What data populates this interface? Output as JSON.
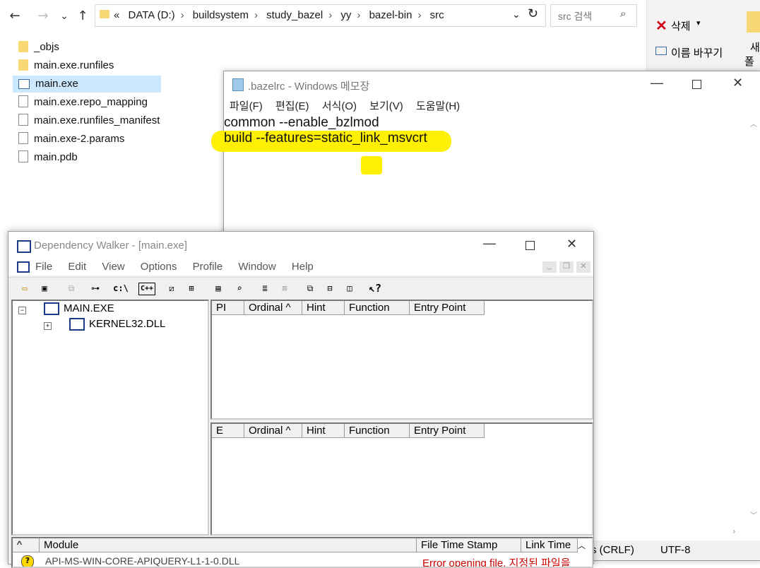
{
  "explorer": {
    "nav": {
      "back": "←",
      "forward": "→",
      "recent": "⌄",
      "up": "↑"
    },
    "address": {
      "chevron": "«",
      "crumbs": [
        "DATA (D:)",
        "buildsystem",
        "study_bazel",
        "yy",
        "bazel-bin",
        "src"
      ]
    },
    "search_placeholder": "src 검색",
    "files": [
      {
        "name": "_objs",
        "type": "folder"
      },
      {
        "name": "main.exe.runfiles",
        "type": "folder"
      },
      {
        "name": "main.exe",
        "type": "exe"
      },
      {
        "name": "main.exe.repo_mapping",
        "type": "doc"
      },
      {
        "name": "main.exe.runfiles_manifest",
        "type": "doc"
      },
      {
        "name": "main.exe-2.params",
        "type": "doc"
      },
      {
        "name": "main.pdb",
        "type": "doc"
      }
    ],
    "ribbon": {
      "delete": "삭제",
      "rename": "이름 바꾸기",
      "new_folder_1": "새",
      "new_folder_2": "폴더"
    }
  },
  "notepad": {
    "title": ".bazelrc - Windows 메모장",
    "menu": [
      "파일(F)",
      "편집(E)",
      "서식(O)",
      "보기(V)",
      "도움말(H)"
    ],
    "lines": [
      "common --enable_bzlmod",
      "build --features=static_link_msvcrt"
    ],
    "highlight_color": "#ffef00",
    "status_eol": "s (CRLF)",
    "status_enc": "UTF-8"
  },
  "depwalk": {
    "title": "Dependency Walker - [main.exe]",
    "menu": [
      "File",
      "Edit",
      "View",
      "Options",
      "Profile",
      "Window",
      "Help"
    ],
    "toolbar": {
      "path": "c:\\",
      "cpp": "C++",
      "help": "?"
    },
    "tree": [
      {
        "label": "MAIN.EXE"
      },
      {
        "label": "KERNEL32.DLL"
      }
    ],
    "import_cols": [
      "PI",
      "Ordinal ^",
      "Hint",
      "Function",
      "Entry Point"
    ],
    "export_cols": [
      "E",
      "Ordinal ^",
      "Hint",
      "Function",
      "Entry Point"
    ],
    "module_cols": [
      "^",
      "Module",
      "File Time Stamp",
      "Link Time"
    ],
    "module_rows": [
      {
        "module": "API-MS-WIN-CORE-APIQUERY-L1-1-0.DLL",
        "status": "Error opening file. 지정된 파일을"
      }
    ]
  }
}
